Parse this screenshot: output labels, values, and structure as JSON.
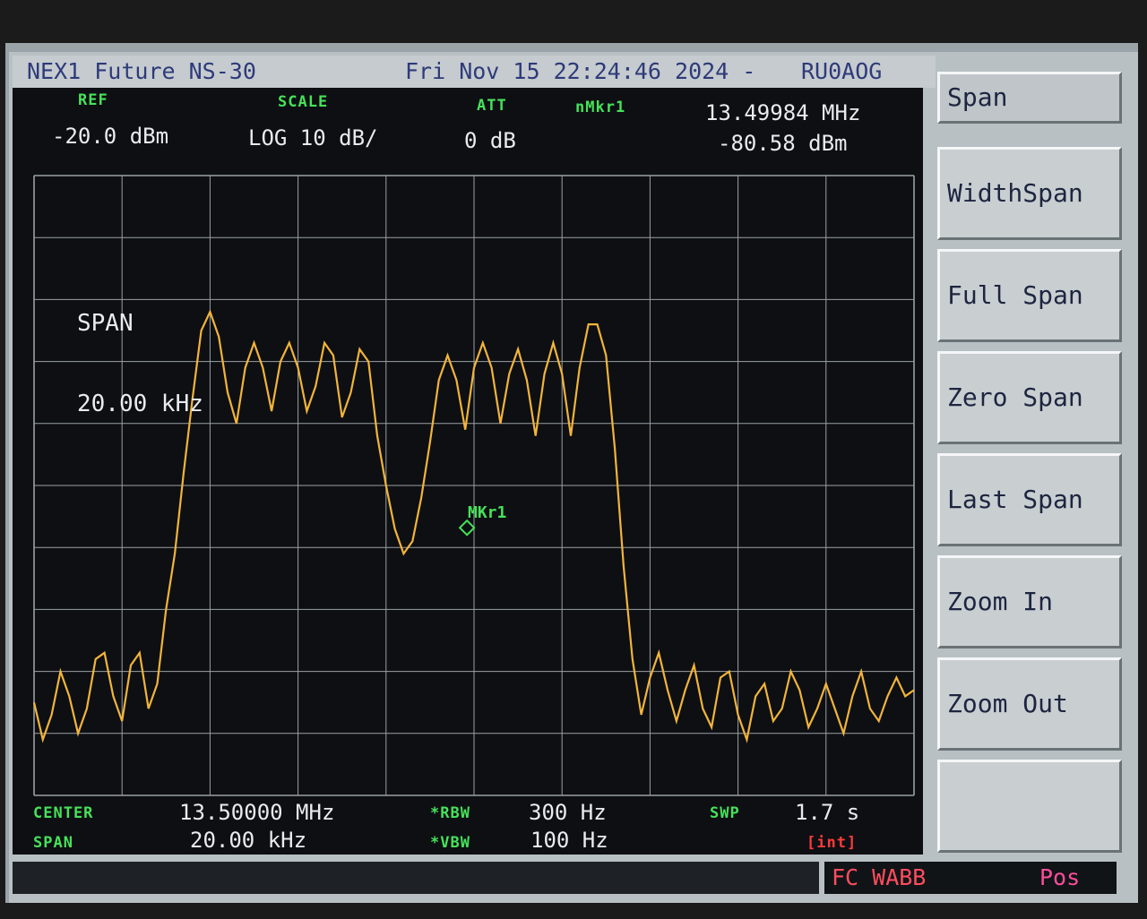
{
  "title_bar": {
    "model": "NEX1 Future NS-30",
    "datetime": "Fri Nov 15 22:24:46 2024 -",
    "callsign": "RU0AOG"
  },
  "header": {
    "ref_label": "REF",
    "ref_value": "-20.0 dBm",
    "scale_label": "SCALE",
    "scale_value": "LOG 10 dB/",
    "att_label": "ATT",
    "att_value": "0 dB",
    "marker_label": "nMkr1",
    "marker_freq": "13.49984 MHz",
    "marker_level": "-80.58 dBm"
  },
  "annotation": {
    "span_line1": "SPAN",
    "span_line2": "20.00 kHz",
    "marker_tag": "MKr1"
  },
  "footer": {
    "center_label": "CENTER",
    "center_value": "13.50000 MHz",
    "span_label": "SPAN",
    "span_value": "20.00 kHz",
    "rbw_label": "*RBW",
    "rbw_value": "300 Hz",
    "vbw_label": "*VBW",
    "vbw_value": "100 Hz",
    "swp_label": "SWP",
    "swp_value": "1.7 s",
    "int_tag": "[int]"
  },
  "softkeys": {
    "header": "Span",
    "items": [
      "WidthSpan",
      "Full Span",
      "Zero Span",
      "Last Span",
      "Zoom In",
      "Zoom Out",
      ""
    ]
  },
  "status": {
    "fc": "FC WABB",
    "pos": "Pos"
  },
  "colors": {
    "trace": "#f2b43a",
    "grid": "#9aa0a6",
    "label_green": "#46e25a"
  },
  "chart_data": {
    "type": "line",
    "ylim": [
      -120,
      -20
    ],
    "xlim": [
      13.49,
      13.51
    ],
    "x_unit": "MHz",
    "y_unit": "dBm",
    "series": [
      {
        "x": [
          13.49,
          13.4902,
          13.4904,
          13.4906,
          13.4908,
          13.491,
          13.4912,
          13.4914,
          13.4916,
          13.4918,
          13.492,
          13.4922,
          13.4924,
          13.4926,
          13.4928,
          13.493,
          13.4932,
          13.4934,
          13.4936,
          13.4938,
          13.494,
          13.4942,
          13.4944,
          13.4946,
          13.4948,
          13.495,
          13.4952,
          13.4954,
          13.4956,
          13.4958,
          13.496,
          13.4962,
          13.4964,
          13.4966,
          13.4968,
          13.497,
          13.4972,
          13.4974,
          13.4976,
          13.4978,
          13.498,
          13.4982,
          13.4984,
          13.4986,
          13.4988,
          13.499,
          13.4992,
          13.4994,
          13.4996,
          13.4998,
          13.5,
          13.5002,
          13.5004,
          13.5006,
          13.5008,
          13.501,
          13.5012,
          13.5014,
          13.5016,
          13.5018,
          13.502,
          13.5022,
          13.5024,
          13.5026,
          13.5028,
          13.503,
          13.5032,
          13.5034,
          13.5036,
          13.5038,
          13.504,
          13.5042,
          13.5044,
          13.5046,
          13.5048,
          13.505,
          13.5052,
          13.5054,
          13.5056,
          13.5058,
          13.506,
          13.5062,
          13.5064,
          13.5066,
          13.5068,
          13.507,
          13.5072,
          13.5074,
          13.5076,
          13.5078,
          13.508,
          13.5082,
          13.5084,
          13.5086,
          13.5088,
          13.509,
          13.5092,
          13.5094,
          13.5096,
          13.5098,
          13.51
        ],
        "y": [
          -105,
          -111,
          -107,
          -100,
          -104,
          -110,
          -106,
          -98,
          -97,
          -104,
          -108,
          -99,
          -97,
          -106,
          -102,
          -90,
          -81,
          -68,
          -56,
          -45,
          -42,
          -46,
          -55,
          -60,
          -51,
          -47,
          -51,
          -58,
          -50,
          -47,
          -51,
          -58,
          -54,
          -47,
          -49,
          -59,
          -55,
          -48,
          -50,
          -62,
          -70,
          -77,
          -81,
          -79,
          -72,
          -63,
          -53,
          -49,
          -53,
          -61,
          -51,
          -47,
          -51,
          -60,
          -52,
          -48,
          -53,
          -62,
          -52,
          -47,
          -52,
          -62,
          -51,
          -44,
          -44,
          -49,
          -64,
          -83,
          -98,
          -107,
          -101,
          -97,
          -103,
          -108,
          -103,
          -99,
          -106,
          -109,
          -101,
          -100,
          -107,
          -111,
          -104,
          -102,
          -108,
          -106,
          -100,
          -103,
          -109,
          -106,
          -102,
          -106,
          -110,
          -104,
          -100,
          -106,
          -108,
          -104,
          -101,
          -104,
          -103
        ]
      }
    ],
    "marker": {
      "label": "MKr1",
      "x": 13.49984,
      "y": -80.58
    }
  }
}
